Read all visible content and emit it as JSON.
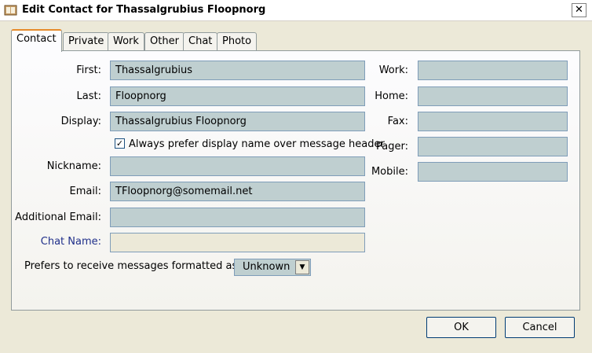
{
  "window": {
    "title": "Edit Contact for Thassalgrubius Floopnorg",
    "close_symbol": "✕"
  },
  "tabs": [
    {
      "label": "Contact"
    },
    {
      "label": "Private"
    },
    {
      "label": "Work"
    },
    {
      "label": "Other"
    },
    {
      "label": "Chat"
    },
    {
      "label": "Photo"
    }
  ],
  "contact": {
    "first": {
      "label": "First:",
      "value": "Thassalgrubius"
    },
    "last": {
      "label": "Last:",
      "value": "Floopnorg"
    },
    "display": {
      "label": "Display:",
      "value": "Thassalgrubius Floopnorg"
    },
    "prefer_display": {
      "label": "Always prefer display name over message header",
      "checked": true,
      "mark": "✓"
    },
    "nickname": {
      "label": "Nickname:",
      "value": ""
    },
    "email": {
      "label": "Email:",
      "value": "TFloopnorg@somemail.net"
    },
    "additional_email": {
      "label": "Additional Email:",
      "value": ""
    },
    "chat_name": {
      "label": "Chat Name:",
      "value": ""
    },
    "format": {
      "label": "Prefers to receive messages formatted as:",
      "value": "Unknown"
    }
  },
  "phones": {
    "work": {
      "label": "Work:",
      "value": ""
    },
    "home": {
      "label": "Home:",
      "value": ""
    },
    "fax": {
      "label": "Fax:",
      "value": ""
    },
    "pager": {
      "label": "Pager:",
      "value": ""
    },
    "mobile": {
      "label": "Mobile:",
      "value": ""
    }
  },
  "buttons": {
    "ok": "OK",
    "cancel": "Cancel"
  },
  "colors": {
    "field_bg": "#BFCFD0",
    "window_bg": "#ECE9D8",
    "tab_accent": "#E68B2C"
  }
}
